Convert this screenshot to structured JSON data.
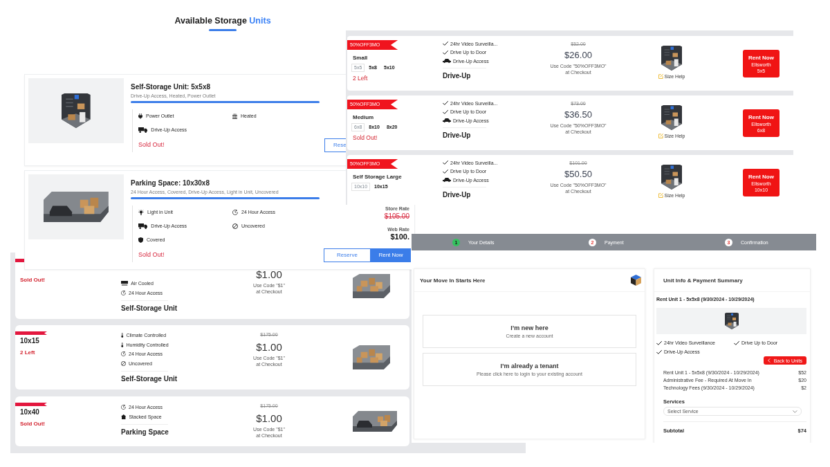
{
  "storage_page": {
    "heading": "Available Storage",
    "heading_accent": "Units",
    "units": [
      {
        "kind": "storage",
        "title": "Self-Storage Unit: 5x5x8",
        "summary": "Drive-Up Access, Heated, Power Outlet",
        "features": [
          {
            "kind": "power",
            "label": "Power Outlet"
          },
          {
            "kind": "heat",
            "label": "Heated"
          },
          {
            "kind": "driveup",
            "label": "Drive-Up Access"
          }
        ],
        "status": "Sold Out!",
        "buttons": [
          {
            "kind": "outline",
            "label": "Rese"
          }
        ]
      },
      {
        "kind": "parking",
        "title": "Parking Space: 10x30x8",
        "summary": "24 Hour Access, Covered, Drive-Up Access, Light in Unit, Uncovered",
        "features": [
          {
            "kind": "light",
            "label": "Light in Unit"
          },
          {
            "kind": "hours",
            "label": "24 Hour Access"
          },
          {
            "kind": "driveup",
            "label": "Drive-Up Access"
          },
          {
            "kind": "uncovered",
            "label": "Uncovered"
          },
          {
            "kind": "covered",
            "label": "Covered"
          }
        ],
        "status": "Sold Out!",
        "rates": [
          {
            "kind": "store",
            "label": "Store Rate",
            "value": "$105.00"
          },
          {
            "kind": "web",
            "label": "Web Rate",
            "value": "$100."
          }
        ],
        "buttons": [
          {
            "kind": "outline",
            "label": "Reserve"
          },
          {
            "kind": "filled",
            "label": "Rent Now"
          }
        ]
      }
    ]
  },
  "promo_list": {
    "rows": [
      {
        "promo": "50%OFF3MO",
        "name": "Small",
        "sizes": [
          {
            "label": "5x5",
            "selected": true
          },
          {
            "label": "5x8",
            "selected": false
          },
          {
            "label": "5x10",
            "selected": false
          }
        ],
        "availability": "2 Left",
        "features": [
          {
            "kind": "check",
            "label": "24hr Video Surveilla..."
          },
          {
            "kind": "check",
            "label": "Drive Up to Door"
          },
          {
            "kind": "car",
            "label": "Drive-Up Access"
          }
        ],
        "type": "Drive-Up",
        "old_price": "$52.00",
        "price": "$26.00",
        "code_note": "Use Code \"50%OFF3MO\"",
        "checkout_note": "at Checkout",
        "help": "Size Help",
        "rent": {
          "label": "Rent Now",
          "location": "Ellsworth",
          "size": "5x5"
        }
      },
      {
        "promo": "50%OFF3MO",
        "name": "Medium",
        "sizes": [
          {
            "label": "6x8",
            "selected": true
          },
          {
            "label": "8x10",
            "selected": false
          },
          {
            "label": "8x20",
            "selected": false
          }
        ],
        "availability": "Sold Out!",
        "features": [
          {
            "kind": "check",
            "label": "24hr Video Surveilla..."
          },
          {
            "kind": "check",
            "label": "Drive Up to Door"
          },
          {
            "kind": "car",
            "label": "Drive-Up Access"
          }
        ],
        "type": "Drive-Up",
        "old_price": "$73.00",
        "price": "$36.50",
        "code_note": "Use Code \"50%OFF3MO\"",
        "checkout_note": "at Checkout",
        "help": "Size Help",
        "rent": {
          "label": "Rent Now",
          "location": "Ellsworth",
          "size": "6x8"
        }
      },
      {
        "promo": "50%OFF3MO",
        "name": "Self Storage Large",
        "sizes": [
          {
            "label": "10x10",
            "selected": true
          },
          {
            "label": "10x15",
            "selected": false
          }
        ],
        "features": [
          {
            "kind": "check",
            "label": "24hr Video Surveilla..."
          },
          {
            "kind": "check",
            "label": "Drive Up to Door"
          },
          {
            "kind": "car",
            "label": "Drive-Up Access"
          }
        ],
        "type": "Drive-Up",
        "old_price": "$101.00",
        "price": "$50.50",
        "code_note": "Use Code \"50%OFF3MO\"",
        "checkout_note": "at Checkout",
        "help": "Size Help",
        "rent": {
          "label": "Rent Now",
          "location": "Ellsworth",
          "size": "10x10"
        }
      }
    ]
  },
  "compact_list": {
    "rows": [
      {
        "kind": "storage",
        "status": "Sold Out!",
        "features": [
          {
            "kind": "ac",
            "label": "Air Cooled"
          },
          {
            "kind": "hours",
            "label": "24 Hour Access"
          }
        ],
        "type": "Self-Storage Unit",
        "price": "$1.00",
        "code_note": "Use Code \"$1\"",
        "checkout_note": "at Checkout"
      },
      {
        "kind": "storage",
        "size": "10x15",
        "status": "2 Left",
        "features": [
          {
            "kind": "climate",
            "label": "Climate Controlled"
          },
          {
            "kind": "humidity",
            "label": "Humidity Controlled"
          },
          {
            "kind": "hours",
            "label": "24 Hour Access"
          },
          {
            "kind": "uncovered",
            "label": "Uncovered"
          }
        ],
        "type": "Self-Storage Unit",
        "old_price": "$175.00",
        "price": "$1.00",
        "code_note": "Use Code \"$1\"",
        "checkout_note": "at Checkout"
      },
      {
        "kind": "parking",
        "size": "10x40",
        "status": "Sold Out!",
        "features": [
          {
            "kind": "hours",
            "label": "24 Hour Access"
          },
          {
            "kind": "stacked",
            "label": "Stacked Space"
          }
        ],
        "type": "Parking Space",
        "old_price": "$175.00",
        "price": "$1.00",
        "code_note": "Use Code \"$1\"",
        "checkout_note": "at Checkout"
      }
    ]
  },
  "checkout": {
    "steps": [
      {
        "number": "1",
        "label": "Your Details",
        "selected": true
      },
      {
        "number": "2",
        "label": "Payment",
        "selected": false
      },
      {
        "number": "3",
        "label": "Confirmation",
        "selected": false
      }
    ],
    "move_in": {
      "title": "Your Move In Starts Here",
      "options": [
        {
          "title": "I’m new here",
          "subtitle": "Create a new account"
        },
        {
          "title": "I’m already a tenant",
          "subtitle": "Please click here to login to your existing account"
        }
      ]
    },
    "summary": {
      "title": "Unit Info & Payment Summary",
      "unit": "Rent Unit 1 - 5x5x8 (9/30/2024 - 10/29/2024)",
      "amenities": [
        "24hr Video Surveillance",
        "Drive Up to Door",
        "Drive-Up Access"
      ],
      "back_button": "Back to Units",
      "charges": [
        {
          "label": "Rent Unit 1 - 5x5x8 (9/30/2024 - 10/29/2024)",
          "amount": "$52"
        },
        {
          "label": "Administrative Fee - Required At Move In",
          "amount": "$20"
        },
        {
          "label": "Technology Fees (9/30/2024 - 10/29/2024)",
          "amount": "$2"
        }
      ],
      "services_label": "Services",
      "service_select": {
        "placeholder": "Select Service"
      },
      "subtotal_label": "Subtotal",
      "subtotal": "$74"
    }
  }
}
